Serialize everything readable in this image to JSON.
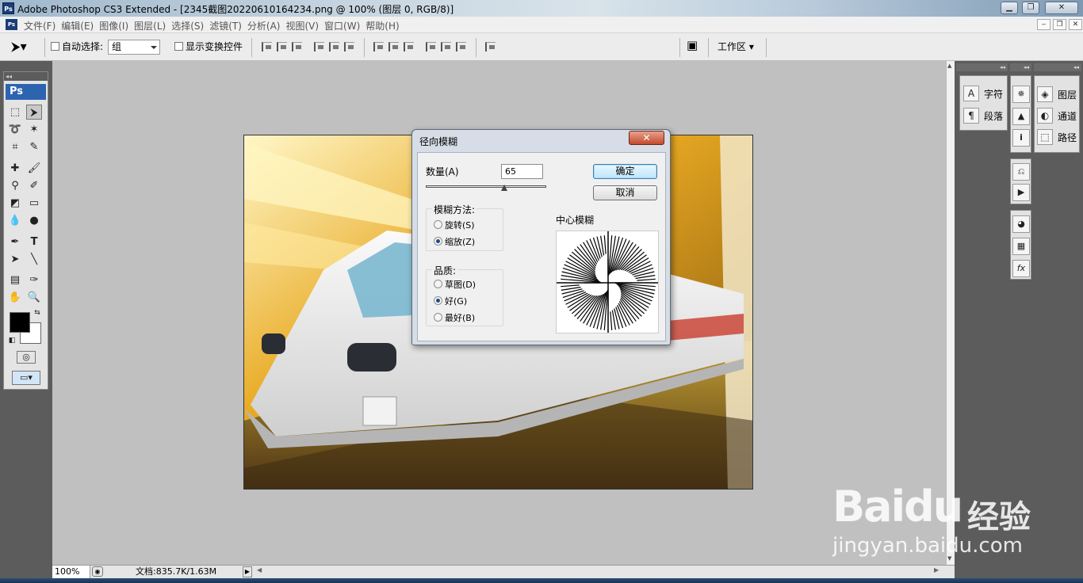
{
  "window": {
    "title": "Adobe Photoshop CS3 Extended - [2345截图20220610164234.png @ 100% (图层 0, RGB/8)]",
    "controls": {
      "minimize": "▁",
      "restore": "❐",
      "close": "✕"
    }
  },
  "menu": {
    "items": [
      "文件(F)",
      "编辑(E)",
      "图像(I)",
      "图层(L)",
      "选择(S)",
      "滤镜(T)",
      "分析(A)",
      "视图(V)",
      "窗口(W)",
      "帮助(H)"
    ],
    "doc_controls": {
      "minimize": "‒",
      "restore": "❐",
      "close": "✕"
    }
  },
  "options": {
    "auto_select_label": "自动选择:",
    "auto_select_value": "组",
    "show_transform_label": "显示变换控件",
    "workspace_label": "工作区 ▾"
  },
  "toolbox": {
    "logo": "Ps"
  },
  "dialog": {
    "title": "径向模糊",
    "close": "✕",
    "amount_label": "数量(A)",
    "amount_value": "65",
    "amount_fraction": 0.65,
    "ok": "确定",
    "cancel": "取消",
    "method_title": "模糊方法:",
    "methods": [
      {
        "label": "旋转(S)",
        "selected": false
      },
      {
        "label": "缩放(Z)",
        "selected": true
      }
    ],
    "quality_title": "品质:",
    "qualities": [
      {
        "label": "草图(D)",
        "selected": false
      },
      {
        "label": "好(G)",
        "selected": true
      },
      {
        "label": "最好(B)",
        "selected": false
      }
    ],
    "center_label": "中心模糊"
  },
  "status": {
    "zoom": "100%",
    "doc_info": "文档:835.7K/1.63M"
  },
  "panels": {
    "character": "字符",
    "paragraph": "段落",
    "layers": "图层",
    "channels": "通道",
    "paths": "路径"
  },
  "watermark": {
    "logo": "Baidu",
    "logo_cn": "经验",
    "url": "jingyan.baidu.com"
  },
  "colors": {
    "foreground": "#000000",
    "background": "#ffffff",
    "dialog_primary_button": "#bee6fd",
    "close_button": "#c44a2e"
  }
}
